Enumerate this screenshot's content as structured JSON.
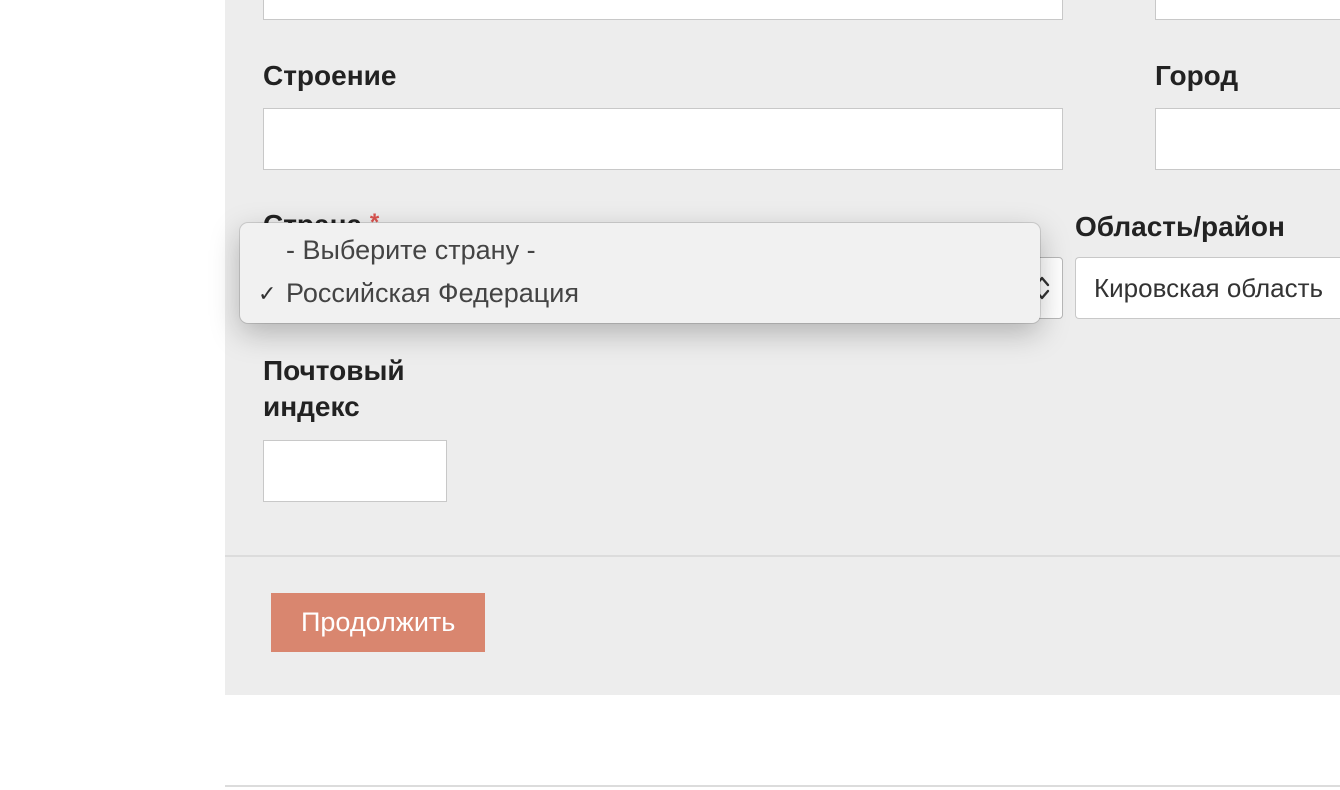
{
  "form": {
    "building": {
      "label": "Строение",
      "value": ""
    },
    "city": {
      "label": "Город",
      "value": ""
    },
    "country": {
      "label": "Страна",
      "required_mark": "*",
      "dropdown": {
        "options": [
          {
            "label": "- Выберите страну -",
            "selected": false
          },
          {
            "label": "Российская Федерация",
            "selected": true
          }
        ]
      }
    },
    "region": {
      "label": "Область/район",
      "value": "Кировская область"
    },
    "postal": {
      "label": "Почтовый индекс",
      "value": ""
    }
  },
  "actions": {
    "continue_label": "Продолжить"
  }
}
